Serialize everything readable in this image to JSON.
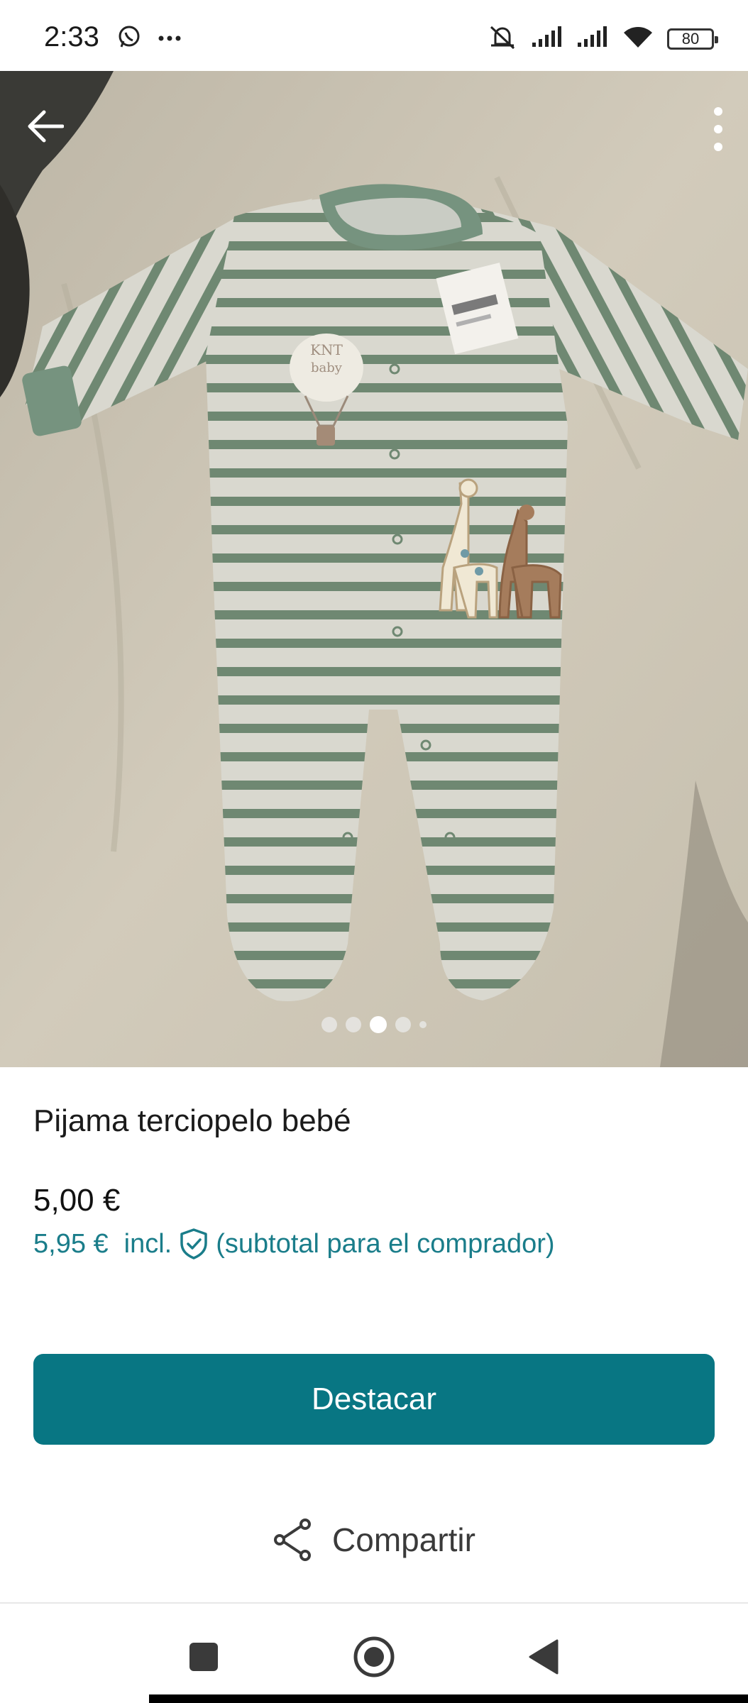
{
  "status_bar": {
    "time": "2:33",
    "battery": "80",
    "icons": [
      "whatsapp-icon",
      "more-dots-icon",
      "mute-icon",
      "signal-icon",
      "signal-icon",
      "wifi-icon",
      "battery-icon"
    ]
  },
  "photo": {
    "description_icons": [
      "back-arrow-icon",
      "kebab-menu-icon"
    ],
    "pager": {
      "count": 5,
      "active_index": 2
    }
  },
  "product": {
    "title": "Pijama terciopelo bebé",
    "price": "5,00 €",
    "buyer_price": "5,95 €",
    "incl_label": "incl.",
    "subtotal_label": "(subtotal para el comprador)"
  },
  "actions": {
    "primary_label": "Destacar",
    "share_label": "Compartir"
  },
  "colors": {
    "accent": "#087683",
    "price_link": "#1a7d8a"
  },
  "navbar": {
    "icons": [
      "recents-square-icon",
      "home-circle-icon",
      "back-triangle-icon"
    ]
  }
}
